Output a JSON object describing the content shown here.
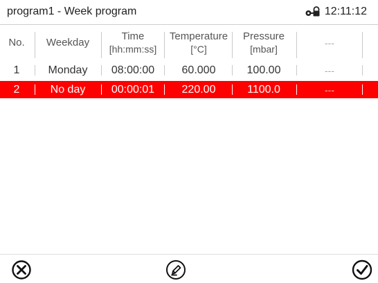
{
  "header": {
    "title": "program1 - Week program",
    "clock": "12:11:12",
    "lock_icon": "lock-key-icon"
  },
  "table": {
    "columns": [
      {
        "label": "No.",
        "unit": ""
      },
      {
        "label": "Weekday",
        "unit": ""
      },
      {
        "label": "Time",
        "unit": "[hh:mm:ss]"
      },
      {
        "label": "Temperature",
        "unit": "[°C]"
      },
      {
        "label": "Pressure",
        "unit": "[mbar]"
      },
      {
        "label": "---",
        "unit": ""
      }
    ],
    "rows": [
      {
        "no": "1",
        "weekday": "Monday",
        "time": "08:00:00",
        "temperature": "60.000",
        "pressure": "100.00",
        "extra": "---",
        "selected": false
      },
      {
        "no": "2",
        "weekday": "No day",
        "time": "00:00:01",
        "temperature": "220.00",
        "pressure": "1100.0",
        "extra": "---",
        "selected": true
      }
    ]
  },
  "footer": {
    "cancel_icon": "cancel-circle-icon",
    "edit_icon": "edit-pencil-icon",
    "confirm_icon": "confirm-check-icon"
  },
  "colors": {
    "selection": "#ff0000",
    "header_text": "#555555",
    "separator": "#c9c9c9"
  }
}
